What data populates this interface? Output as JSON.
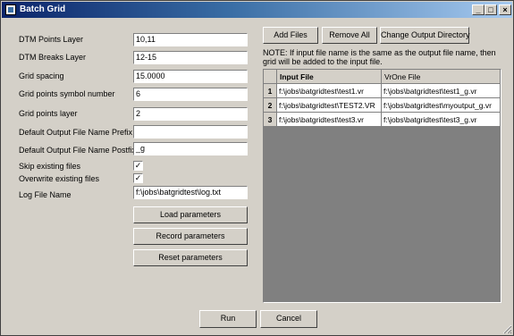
{
  "window": {
    "title": "Batch Grid"
  },
  "titlebar_buttons": {
    "minimize": "_",
    "maximize": "□",
    "close": "×"
  },
  "fields": [
    {
      "label": "DTM Points Layer",
      "value": "10,11"
    },
    {
      "label": "DTM Breaks Layer",
      "value": "12-15"
    },
    {
      "label": "Grid spacing",
      "value": "15.0000"
    },
    {
      "label": "Grid points symbol number",
      "value": "6"
    },
    {
      "label": "Grid points layer",
      "value": "2"
    },
    {
      "label": "Default Output File Name Prefix",
      "value": ""
    },
    {
      "label": "Default Output File Name Postfix",
      "value": "_g"
    }
  ],
  "checkboxes": [
    {
      "label": "Skip existing files",
      "checked": true,
      "mark": "✓"
    },
    {
      "label": "Overwrite existing files",
      "checked": true,
      "mark": "✓"
    }
  ],
  "log": {
    "label": "Log File Name",
    "value": "f:\\jobs\\batgridtest\\log.txt"
  },
  "buttons": {
    "load": "Load parameters",
    "record": "Record parameters",
    "reset": "Reset parameters",
    "add_files": "Add Files",
    "remove_all": "Remove All",
    "change_output": "Change Output Directory",
    "run": "Run",
    "cancel": "Cancel"
  },
  "note": "NOTE: If input file name is the same as the output file name, then grid will be added to the input file.",
  "table": {
    "headers": [
      "Input File",
      "VrOne File"
    ],
    "rows": [
      {
        "num": "1",
        "input": "f:\\jobs\\batgridtest\\test1.vr",
        "vrone": "f:\\jobs\\batgridtest\\test1_g.vr"
      },
      {
        "num": "2",
        "input": "f:\\jobs\\batgridtest\\TEST2.VR",
        "vrone": "f:\\jobs\\batgridtest\\myoutput_g.vr"
      },
      {
        "num": "3",
        "input": "f:\\jobs\\batgridtest\\test3.vr",
        "vrone": "f:\\jobs\\batgridtest\\test3_g.vr"
      }
    ]
  }
}
